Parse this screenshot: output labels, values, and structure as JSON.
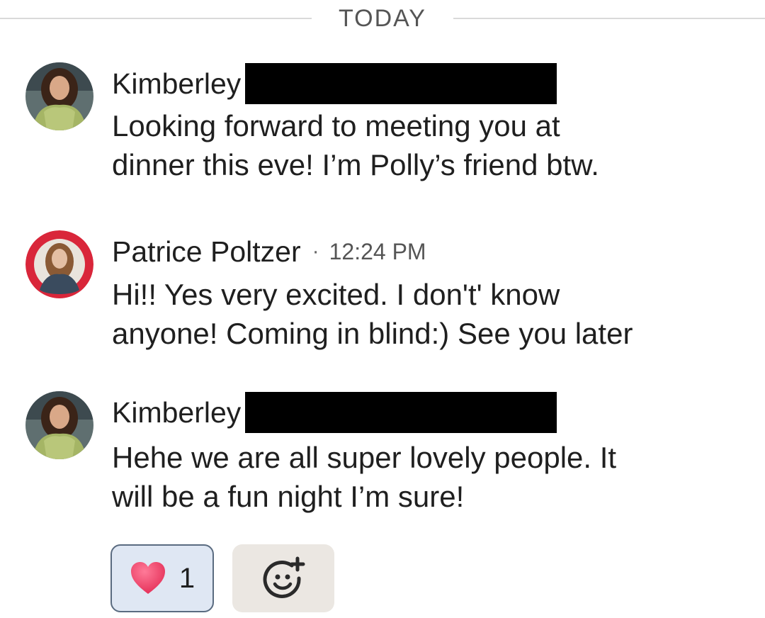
{
  "divider": {
    "label": "TODAY"
  },
  "messages": [
    {
      "sender": "Kimberley",
      "name_redacted": true,
      "timestamp": "",
      "lines": [
        "Looking forward to meeting you at",
        "dinner this eve! I’m Polly’s friend btw."
      ]
    },
    {
      "sender": "Patrice Poltzer",
      "separator": "·",
      "timestamp": "12:24 PM",
      "lines": [
        "Hi!! Yes very excited. I don't' know",
        "anyone! Coming in blind:) See you later"
      ]
    },
    {
      "sender": "Kimberley",
      "name_redacted": true,
      "timestamp": "",
      "lines": [
        "Hehe we are all super lovely people. It",
        "will be a fun night I’m sure!"
      ]
    }
  ],
  "reactions": [
    {
      "icon": "heart-icon",
      "emoji": "red heart",
      "count": "1",
      "selected": true
    }
  ],
  "add_reaction": {
    "icon": "add-emoji-icon"
  },
  "colors": {
    "avatar_ring_patrice": "#d9263a",
    "reaction_selected_bg": "#dfe7f3",
    "reaction_selected_border": "#5a6b80",
    "add_reaction_bg": "#ebe7e2",
    "heart": "#f2456e"
  }
}
